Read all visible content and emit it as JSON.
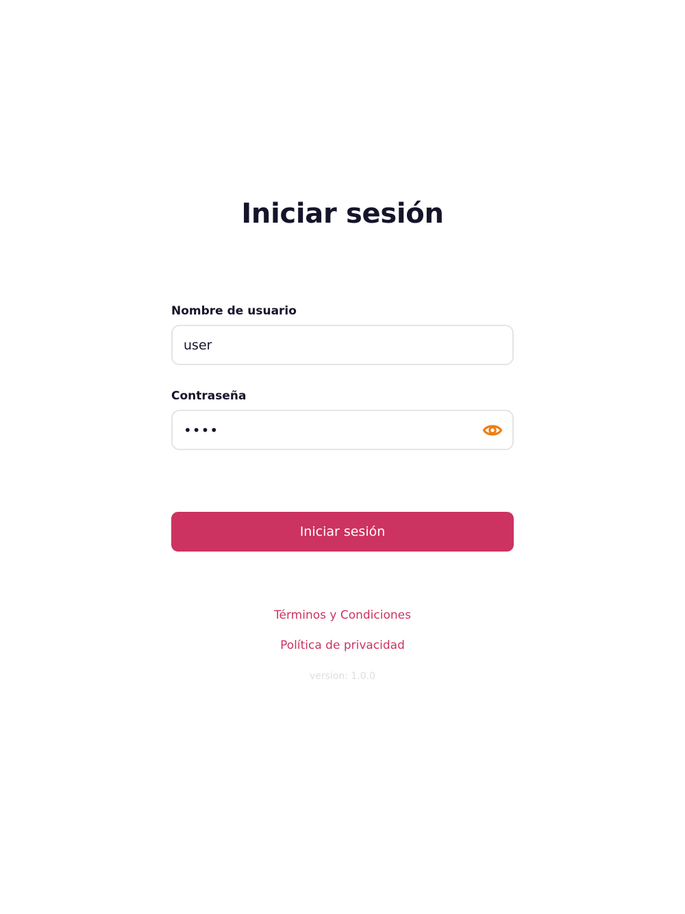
{
  "colors": {
    "accent": "#cc3360",
    "heading": "#15142a",
    "eye_icon": "#ef7d0f",
    "input_border": "#e4e4e8",
    "version_text": "#dddde0"
  },
  "login": {
    "title": "Iniciar sesión",
    "username_label": "Nombre de usuario",
    "username_value": "user",
    "password_label": "Contraseña",
    "password_value": "••••",
    "password_toggle_icon": "eye-icon",
    "submit_label": "Iniciar sesión"
  },
  "footer": {
    "terms_link": "Términos y Condiciones",
    "privacy_link": "Política de privacidad",
    "version": "version: 1.0.0"
  }
}
